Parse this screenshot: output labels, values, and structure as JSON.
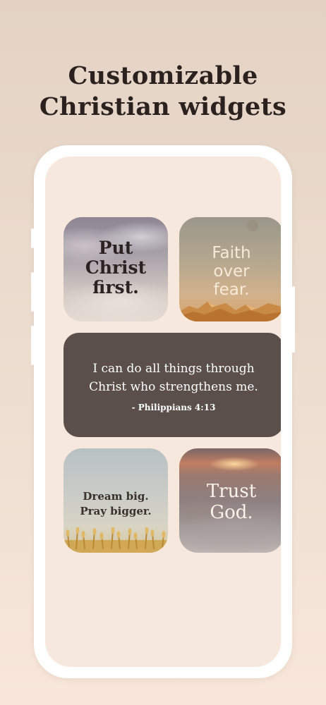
{
  "headline": {
    "line1": "Customizable",
    "line2": "Christian widgets"
  },
  "widgets": {
    "put_christ_first": {
      "line1": "Put",
      "line2": "Christ",
      "line3": "first."
    },
    "faith_over_fear": {
      "line1": "Faith",
      "line2": "over",
      "line3": "fear."
    },
    "verse": {
      "line1": "I can do all things through",
      "line2": "Christ who strengthens me.",
      "reference": "- Philippians 4:13"
    },
    "dream_big": {
      "line1": "Dream big.",
      "line2": "Pray bigger."
    },
    "trust_god": {
      "line1": "Trust",
      "line2": "God."
    }
  },
  "colors": {
    "background_top": "#e4d3c3",
    "background_bottom": "#f8e6da",
    "phone_frame": "#ffffff",
    "phone_screen": "#f7e8dd",
    "verse_widget": "#5a4f4a",
    "headline_text": "#2b2220"
  }
}
